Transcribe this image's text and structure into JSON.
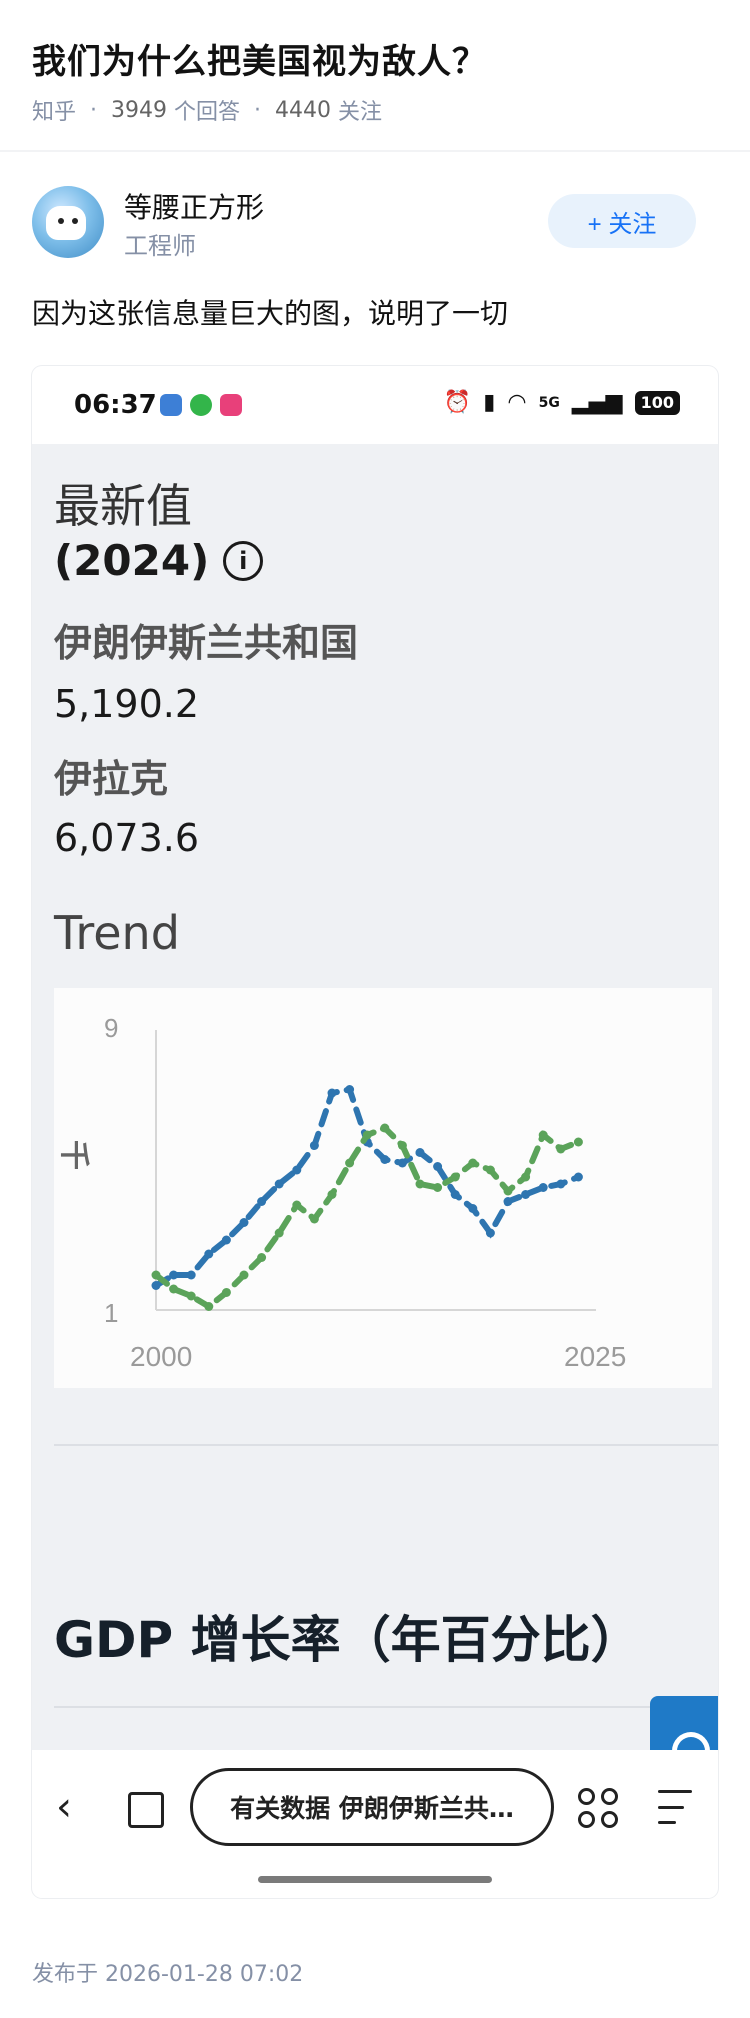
{
  "question": {
    "title": "我们为什么把美国视为敌人？",
    "source": "知乎",
    "answers_count": "3949",
    "answers_label": "个回答",
    "followers_count": "4440",
    "followers_label": "关注"
  },
  "author": {
    "name": "等腰正方形",
    "bio": "工程师",
    "follow_label": "+ 关注"
  },
  "answer": {
    "text": "因为这张信息量巨大的图，说明了一切",
    "published": "发布于  2026-01-28 07:02"
  },
  "screenshot": {
    "status_time": "06:37",
    "battery": "100",
    "signal_label": "5G",
    "latest_label": "最新值",
    "latest_year": "(2024)",
    "info_icon": "info-icon",
    "country1": "伊朗伊斯兰共和国",
    "value1": "5,190.2",
    "country2": "伊拉克",
    "value2": "6,073.6",
    "trend_label": "Trend",
    "gdp_heading": "GDP 增长率（年百分比）",
    "search_pill": "有关数据 伊朗伊斯兰共…"
  },
  "chart_data": {
    "type": "line",
    "ylabel": "千",
    "y_ticks": [
      "9",
      "1"
    ],
    "x_ticks": [
      "2000",
      "2025"
    ],
    "xlim": [
      2000,
      2025
    ],
    "ylim": [
      1,
      9
    ],
    "grid": false,
    "series": [
      {
        "color": "#2e75b0",
        "x": [
          2000,
          2001,
          2002,
          2003,
          2004,
          2005,
          2006,
          2007,
          2008,
          2009,
          2010,
          2011,
          2012,
          2013,
          2014,
          2015,
          2016,
          2017,
          2018,
          2019,
          2020,
          2021,
          2022,
          2023,
          2024
        ],
        "values": [
          1.7,
          2.0,
          2.0,
          2.6,
          3.0,
          3.5,
          4.1,
          4.6,
          5.0,
          5.7,
          7.2,
          7.3,
          5.8,
          5.3,
          5.2,
          5.5,
          5.1,
          4.3,
          3.9,
          3.2,
          4.1,
          4.3,
          4.5,
          4.6,
          4.8
        ]
      },
      {
        "color": "#5ba35a",
        "x": [
          2000,
          2001,
          2002,
          2003,
          2004,
          2005,
          2006,
          2007,
          2008,
          2009,
          2010,
          2011,
          2012,
          2013,
          2014,
          2015,
          2016,
          2017,
          2018,
          2019,
          2020,
          2021,
          2022,
          2023,
          2024
        ],
        "values": [
          2.0,
          1.6,
          1.4,
          1.1,
          1.5,
          2.0,
          2.5,
          3.2,
          4.0,
          3.6,
          4.3,
          5.2,
          6.0,
          6.2,
          5.7,
          4.6,
          4.5,
          4.8,
          5.2,
          5.0,
          4.4,
          4.8,
          6.0,
          5.6,
          5.8
        ]
      }
    ]
  }
}
